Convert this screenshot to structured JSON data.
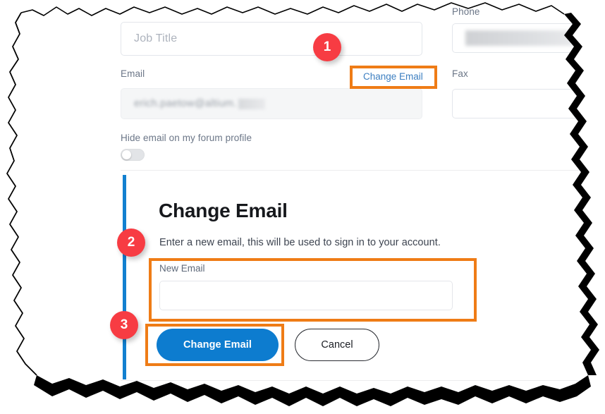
{
  "form": {
    "job_title": {
      "label": "",
      "placeholder": "Job Title",
      "value": ""
    },
    "email": {
      "label": "Email",
      "value": "erich.paetow@altium.",
      "redacted": true
    },
    "change_email_link": "Change Email",
    "hide_email_toggle": {
      "label": "Hide email on my forum profile",
      "state": "off"
    },
    "phone": {
      "label": "Phone",
      "value": "",
      "redacted": true
    },
    "fax": {
      "label": "Fax",
      "value": ""
    }
  },
  "panel": {
    "title": "Change Email",
    "subtitle": "Enter a new email, this will be used to sign in to your account.",
    "new_email": {
      "label": "New Email",
      "value": "",
      "placeholder": ""
    },
    "primary_button": "Change Email",
    "secondary_button": "Cancel"
  },
  "annotations": {
    "steps": [
      {
        "number": "1",
        "target": "change-email-link"
      },
      {
        "number": "2",
        "target": "new-email-field"
      },
      {
        "number": "3",
        "target": "change-email-button"
      }
    ],
    "highlight_color": "#ef7c16",
    "badge_color": "#f73c43",
    "guide_bar_color": "#1280d0"
  }
}
